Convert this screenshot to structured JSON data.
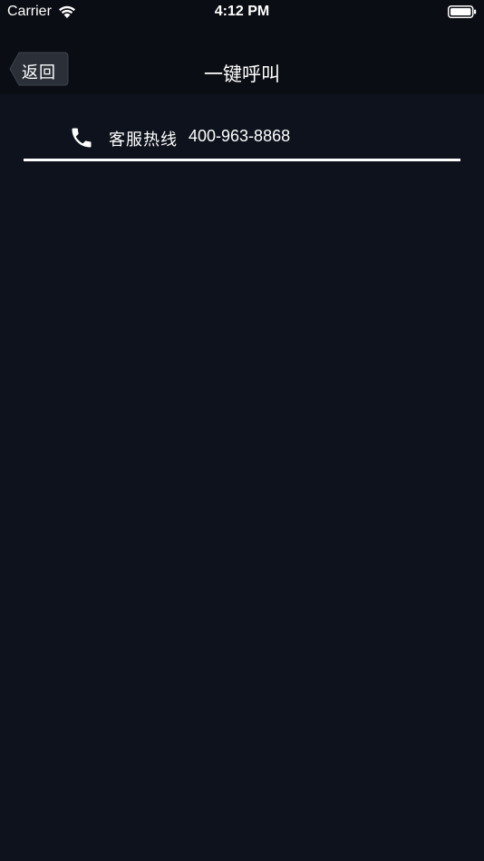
{
  "status_bar": {
    "carrier": "Carrier",
    "time": "4:12 PM",
    "wifi_icon": "wifi-icon",
    "battery_icon": "battery-icon"
  },
  "nav": {
    "back_label": "返回",
    "title": "一键呼叫"
  },
  "hotline": {
    "icon": "phone-icon",
    "label": "客服热线",
    "number": "400-963-8868"
  },
  "colors": {
    "background": "#0d121c",
    "bar": "#0a0d13",
    "text": "#ffffff",
    "back_button": "#2b3038"
  }
}
